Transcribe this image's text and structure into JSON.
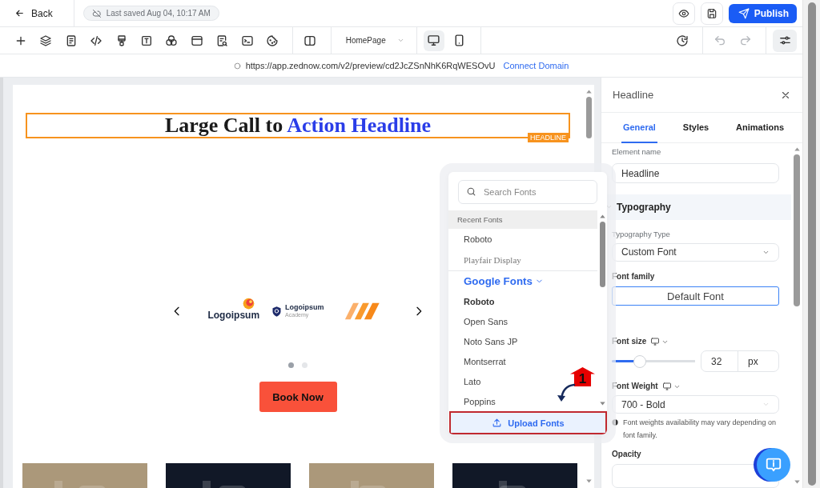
{
  "top_bar": {
    "back": "Back",
    "save_status": "Last saved Aug 04, 10:17 AM",
    "publish": "Publish"
  },
  "toolbar": {
    "page": "HomePage",
    "devices": [
      {
        "kind": "desktop",
        "selected": true
      },
      {
        "kind": "mobile",
        "selected": false
      }
    ],
    "history": [
      {
        "kind": "undo",
        "disabled": true
      },
      {
        "kind": "redo",
        "disabled": true
      }
    ]
  },
  "url_bar": {
    "url": "https://app.zednow.com/v2/preview/cd2JcZSnNhK6RqWESOvU",
    "link": "Connect Domain"
  },
  "canvas": {
    "headline": [
      {
        "text": "Large Call to",
        "accent": false
      },
      {
        "text": "Action Headline",
        "accent": true
      }
    ],
    "element_tag": "HEADLINE",
    "logos": [
      {
        "kind": "sphere",
        "name": "Logoipsum"
      },
      {
        "kind": "shield",
        "name": "Logoipsum",
        "tagline": "Academy"
      },
      {
        "kind": "stripes"
      }
    ],
    "dots": [
      {
        "selected": true
      },
      {
        "selected": false
      }
    ],
    "button": "Book Now"
  },
  "font_picker": {
    "placeholder": "Search Fonts",
    "recent_heading": "Recent Fonts",
    "recent": [
      {
        "name": "Roboto",
        "kind": "sans"
      },
      {
        "name": "Playfair Display",
        "kind": "serif"
      }
    ],
    "group": {
      "label": "Google Fonts",
      "expanded": true
    },
    "fonts": [
      {
        "name": "Roboto",
        "selected": true
      },
      {
        "name": "Open Sans",
        "selected": false
      },
      {
        "name": "Noto Sans JP",
        "selected": false
      },
      {
        "name": "Montserrat",
        "selected": false
      },
      {
        "name": "Lato",
        "selected": false
      },
      {
        "name": "Poppins",
        "selected": false
      }
    ],
    "upload": "Upload Fonts"
  },
  "annotation": {
    "step": "1"
  },
  "panel": {
    "title": "Headline",
    "tabs": [
      {
        "label": "General",
        "selected": true
      },
      {
        "label": "Styles",
        "selected": false
      },
      {
        "label": "Animations",
        "selected": false
      }
    ],
    "element_name": {
      "label": "Element name",
      "value": "Headline"
    },
    "section": {
      "title": "Typography",
      "expanded": true
    },
    "typography_type": {
      "label": "Typography Type",
      "value": "Custom Font"
    },
    "font_family": {
      "label": "Font family",
      "value": "Default Font"
    },
    "font_size": {
      "label": "Font size",
      "level": 0.34,
      "value": "32",
      "unit": "px"
    },
    "font_weight": {
      "label": "Font Weight",
      "value": "700 - Bold",
      "note": "Font weights availability may vary depending on font family."
    },
    "opacity": {
      "label": "Opacity"
    }
  }
}
